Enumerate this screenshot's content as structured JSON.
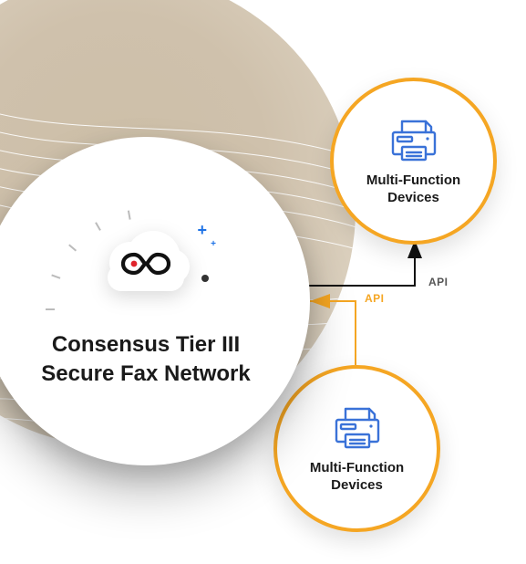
{
  "main": {
    "title_line1": "Consensus Tier III",
    "title_line2": "Secure Fax Network"
  },
  "devices": {
    "top": {
      "label_line1": "Multi-Function",
      "label_line2": "Devices"
    },
    "bottom": {
      "label_line1": "Multi-Function",
      "label_line2": "Devices"
    }
  },
  "api_labels": {
    "dark": "API",
    "orange": "API"
  },
  "colors": {
    "accent": "#f5a623",
    "link_dark": "#111111",
    "icon_blue": "#3a72d8",
    "logo_red": "#e0242c"
  }
}
